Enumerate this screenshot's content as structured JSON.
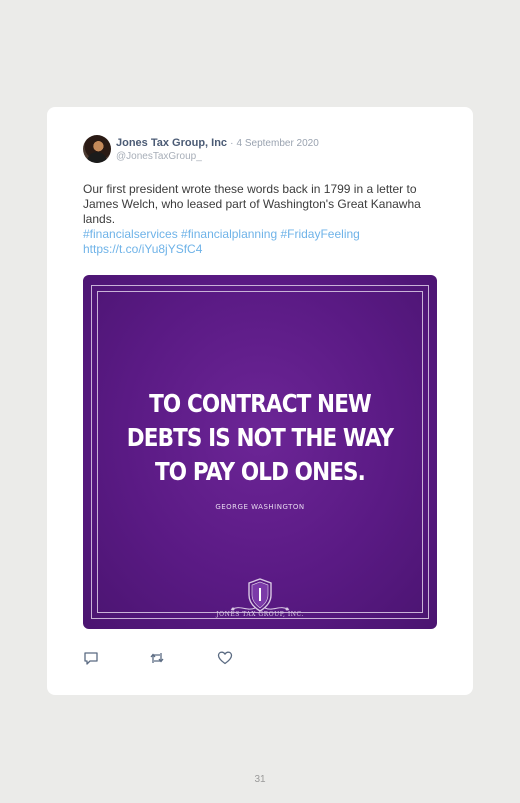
{
  "tweet": {
    "display_name": "Jones Tax Group, Inc",
    "separator": "·",
    "date": "4 September 2020",
    "handle": "@JonesTaxGroup_",
    "text": "Our first president wrote these words back in 1799 in a letter to James Welch, who leased part of Washington's Great Kanawha lands.",
    "hashtags": "#financialservices #financialplanning #FridayFeeling",
    "link": "https://t.co/iYu8jYSfC4"
  },
  "media": {
    "quote_line_1": "TO CONTRACT NEW",
    "quote_line_2": "DEBTS IS NOT THE WAY",
    "quote_line_3": "TO PAY OLD ONES.",
    "author": "GEORGE WASHINGTON",
    "logo_text": "JONES TAX GROUP, INC.",
    "background_color": "#5a1a84"
  },
  "actions": {
    "reply_icon": "reply-icon",
    "retweet_icon": "retweet-icon",
    "like_icon": "heart-icon"
  },
  "footer": {
    "page_number": "31"
  }
}
